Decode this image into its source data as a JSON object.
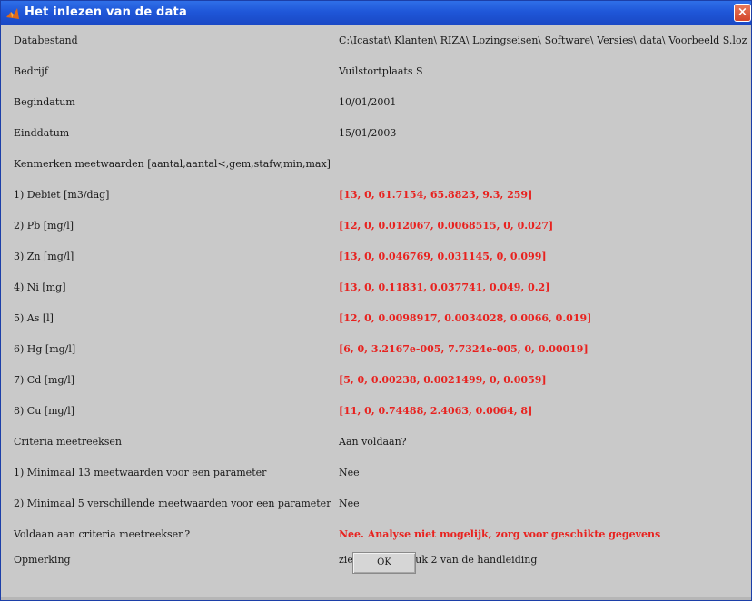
{
  "window": {
    "title": "Het inlezen van de data",
    "close_label": "×"
  },
  "rows": [
    {
      "label": "Databestand",
      "value": "C:\\Icastat\\ Klanten\\ RIZA\\ Lozingseisen\\ Software\\ Versies\\ data\\ Voorbeeld S.loz",
      "red": false
    },
    {
      "label": "Bedrijf",
      "value": "Vuilstortplaats S",
      "red": false
    },
    {
      "label": "Begindatum",
      "value": "10/01/2001",
      "red": false
    },
    {
      "label": "Einddatum",
      "value": "15/01/2003",
      "red": false
    },
    {
      "label": "Kenmerken meetwaarden [aantal,aantal<,gem,stafw,min,max]",
      "value": "",
      "red": false
    },
    {
      "label": "1) Debiet [m3/dag]",
      "value": "[13, 0, 61.7154, 65.8823, 9.3, 259]",
      "red": true
    },
    {
      "label": "2) Pb [mg/l]",
      "value": "[12, 0, 0.012067, 0.0068515, 0, 0.027]",
      "red": true
    },
    {
      "label": "3) Zn [mg/l]",
      "value": "[13, 0, 0.046769, 0.031145, 0, 0.099]",
      "red": true
    },
    {
      "label": "4) Ni [mg]",
      "value": "[13, 0, 0.11831, 0.037741, 0.049, 0.2]",
      "red": true
    },
    {
      "label": "5) As [l]",
      "value": "[12, 0, 0.0098917, 0.0034028, 0.0066, 0.019]",
      "red": true
    },
    {
      "label": "6) Hg [mg/l]",
      "value": "[6, 0, 3.2167e-005, 7.7324e-005, 0, 0.00019]",
      "red": true
    },
    {
      "label": "7) Cd [mg/l]",
      "value": "[5, 0, 0.00238, 0.0021499, 0, 0.0059]",
      "red": true
    },
    {
      "label": "8) Cu [mg/l]",
      "value": "[11, 0, 0.74488, 2.4063, 0.0064, 8]",
      "red": true
    },
    {
      "label": "Criteria meetreeksen",
      "value": "Aan voldaan?",
      "red": false
    },
    {
      "label": "1) Minimaal 13 meetwaarden voor een parameter",
      "value": "Nee",
      "red": false
    },
    {
      "label": "2) Minimaal 5 verschillende meetwaarden voor een parameter",
      "value": "Nee",
      "red": false
    },
    {
      "label": "Voldaan aan criteria meetreeksen?",
      "value": "Nee. Analyse niet mogelijk, zorg voor geschikte gegevens",
      "red": true
    },
    {
      "label": "Opmerking",
      "value": "zie ook hoofdstuk 2 van de handleiding",
      "red": false
    }
  ],
  "ok_label": "OK",
  "colors": {
    "titlebar": "#1f56d8",
    "background": "#c9c9c9",
    "highlight_text": "#e8221f"
  }
}
